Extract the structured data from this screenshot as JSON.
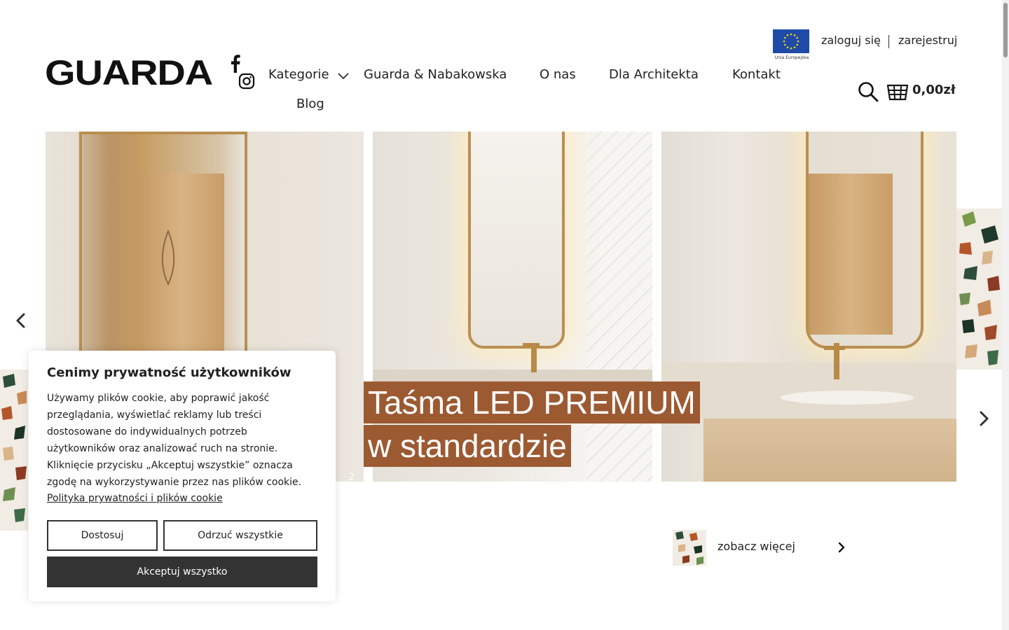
{
  "header": {
    "logo_text": "GUARDA",
    "nav": {
      "kategorie": "Kategorie",
      "guarda_nabakowska": "Guarda & Nabakowska",
      "o_nas": "O nas",
      "dla_architekta": "Dla Architekta",
      "kontakt": "Kontakt",
      "blog": "Blog"
    },
    "eu_caption": "Unia Europejska",
    "login": "zaloguj się",
    "register": "zarejestruj",
    "cart_total": "0,00zł",
    "icons": [
      "facebook-icon",
      "instagram-icon",
      "chevron-down-icon",
      "search-icon",
      "basket-icon"
    ]
  },
  "slider": {
    "banner_line1": "Taśma LED PREMIUM",
    "banner_line2": "w standardzie",
    "slide_number": "2"
  },
  "promo": {
    "see_more": "zobacz więcej"
  },
  "cookie": {
    "title": "Cenimy prywatność użytkowników",
    "body": "Używamy plików cookie, aby poprawić jakość przeglądania, wyświetlać reklamy lub treści dostosowane do indywidualnych potrzeb użytkowników oraz analizować ruch na stronie. Kliknięcie przycisku „Akceptuj wszystkie” oznacza zgodę na wykorzystywanie przez nas plików cookie.",
    "policy_link": "Polityka prywatności i plików cookie",
    "customize": "Dostosuj",
    "reject_all": "Odrzuć wszystkie",
    "accept_all": "Akceptuj wszystko"
  },
  "colors": {
    "banner_bg": "#9c5a33",
    "accept_button": "#333333",
    "eu_blue": "#1f4aa8",
    "eu_star": "#f5d90a"
  }
}
